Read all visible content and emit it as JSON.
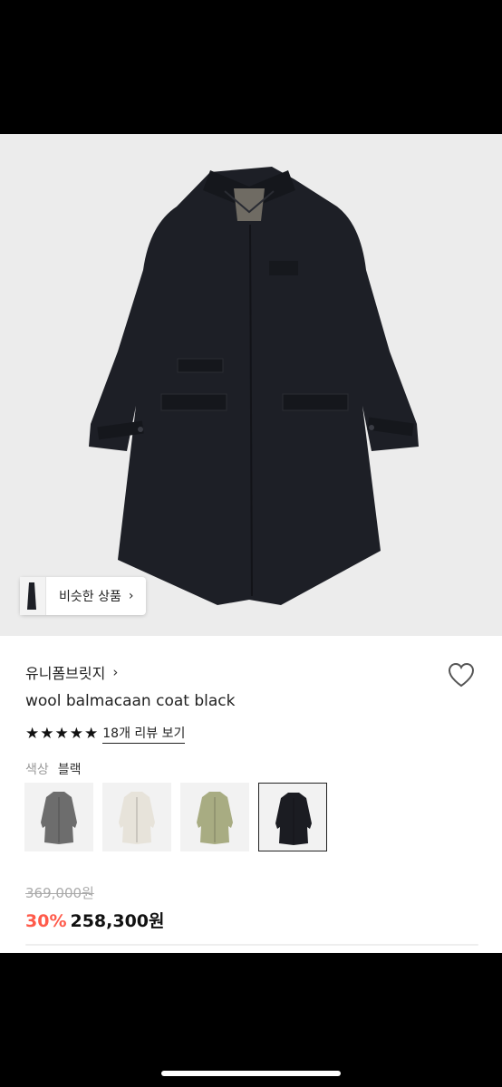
{
  "similar": {
    "label": "비슷한 상품",
    "chevron": "›"
  },
  "product": {
    "brand": "유니폼브릿지",
    "brand_chevron": "›",
    "name": "wool balmacaan coat black",
    "rating": {
      "stars": 5,
      "star_glyph": "★",
      "review_link": "18개 리뷰 보기"
    },
    "color": {
      "label": "색상",
      "value": "블랙"
    },
    "swatches": [
      {
        "name": "gray",
        "color": "#6d6d6d",
        "selected": false
      },
      {
        "name": "ivory",
        "color": "#e7e3da",
        "selected": false
      },
      {
        "name": "olive",
        "color": "#a8ac82",
        "selected": false
      },
      {
        "name": "black",
        "color": "#1b1c22",
        "selected": true
      }
    ],
    "price": {
      "original": "369,000원",
      "discount": "30%",
      "final": "258,300원"
    }
  },
  "colors": {
    "accent_discount": "#ff5a4a",
    "coat_main": "#1d1f26"
  }
}
